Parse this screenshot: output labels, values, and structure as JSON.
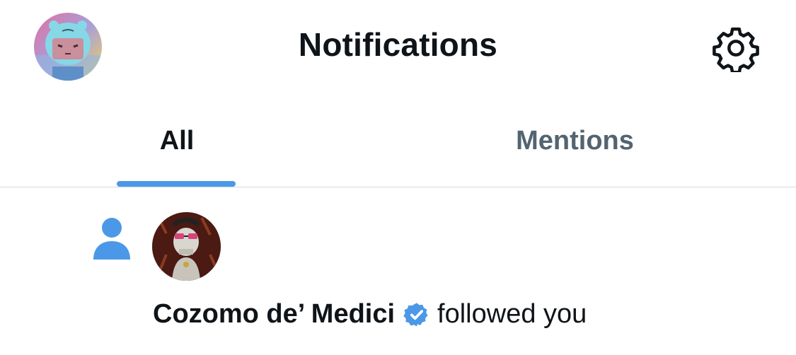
{
  "header": {
    "title": "Notifications",
    "avatar_icon": "robot-helmet-avatar",
    "settings_icon": "gear-icon"
  },
  "tabs": [
    {
      "label": "All",
      "selected": true
    },
    {
      "label": "Mentions",
      "selected": false
    }
  ],
  "colors": {
    "accent": "#4c98e8",
    "text_primary": "#0f1419",
    "text_secondary": "#536471",
    "divider": "#d7d9dc"
  },
  "notifications": [
    {
      "type_icon": "person-icon",
      "user_name": "Cozomo de’ Medici",
      "verified": true,
      "action": "followed you"
    }
  ]
}
